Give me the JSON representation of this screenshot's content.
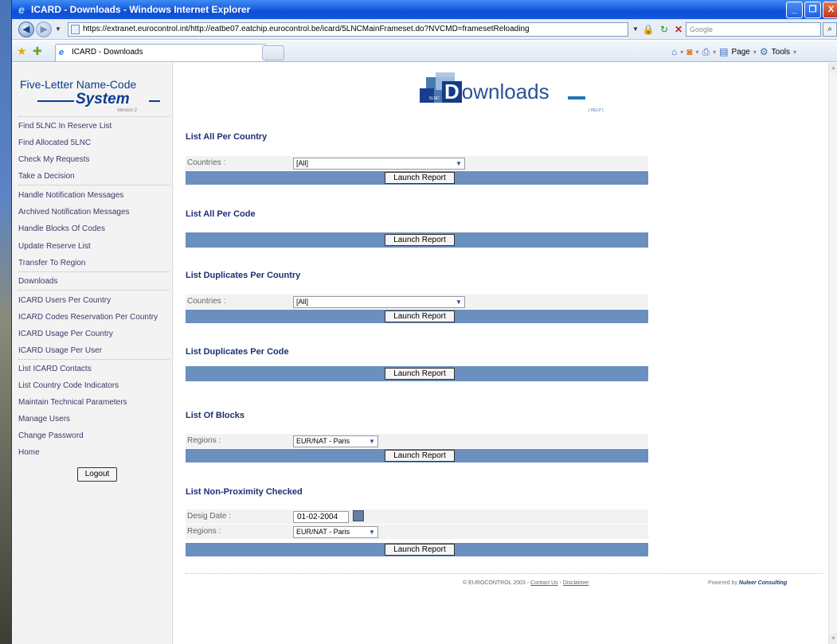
{
  "window": {
    "title": "ICARD - Downloads - Windows Internet Explorer",
    "minimize": "_",
    "maximize": "❐",
    "close": "X"
  },
  "addressbar": {
    "url": "https://extranet.eurocontrol.int/http://eatbe07.eatchip.eurocontrol.be/icard/5LNCMainFrameset.do?NVCMD=framesetReloading",
    "search_placeholder": "Google"
  },
  "tabs": [
    {
      "label": "ICARD - Downloads"
    }
  ],
  "commandbar": {
    "page": "Page",
    "tools": "Tools"
  },
  "logo": {
    "line1": "Five-Letter Name-Code",
    "line2": "System",
    "version": "Version 2"
  },
  "nav": {
    "groups": [
      [
        "Find 5LNC In Reserve List",
        "Find Allocated 5LNC",
        "Check My Requests",
        "Take a Decision"
      ],
      [
        "Handle Notification Messages",
        "Archived Notification Messages",
        "Handle Blocks Of Codes",
        "Update Reserve List",
        "Transfer To Region"
      ],
      [
        "Downloads"
      ],
      [
        "ICARD Users Per Country",
        "ICARD Codes Reservation Per Country",
        "ICARD Usage Per Country",
        "ICARD Usage Per User"
      ],
      [
        "List ICARD Contacts",
        "List Country Code Indicators",
        "Maintain Technical Parameters",
        "Manage Users",
        "Change Password",
        "Home"
      ]
    ],
    "logout": "Logout"
  },
  "header": {
    "title_first": "D",
    "title_rest": "ownloads",
    "small": "5LNC",
    "help": "[ HELP ]"
  },
  "sections": {
    "s1": {
      "title": "List All Per Country",
      "label": "Countries :",
      "value": "[All]",
      "button": "Launch Report"
    },
    "s2": {
      "title": "List All Per Code",
      "button": "Launch Report"
    },
    "s3": {
      "title": "List Duplicates Per Country",
      "label": "Countries :",
      "value": "[All]",
      "button": "Launch Report"
    },
    "s4": {
      "title": "List Duplicates Per Code",
      "button": "Launch Report"
    },
    "s5": {
      "title": "List Of Blocks",
      "label": "Regions :",
      "value": "EUR/NAT - Paris",
      "button": "Launch Report"
    },
    "s6": {
      "title": "List Non-Proximity Checked",
      "date_label": "Desig Date :",
      "date_value": "01-02-2004",
      "region_label": "Regions :",
      "region_value": "EUR/NAT - Paris",
      "button": "Launch Report"
    }
  },
  "footer": {
    "copyright": "© EUROCONTROL 2003 - ",
    "contact": "Contact Us",
    "sep": " - ",
    "disclaimer": "Disclaimer",
    "powered": "Powered by ",
    "brand": "Nuleer Consulting"
  }
}
